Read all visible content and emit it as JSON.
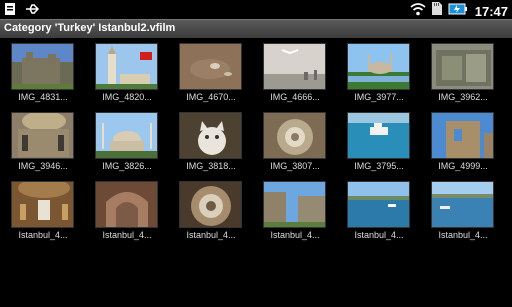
{
  "status": {
    "time": "17:47"
  },
  "titlebar": {
    "title": "Category 'Turkey' Istanbul2.vfilm"
  },
  "photos": [
    {
      "caption": "IMG_4831..."
    },
    {
      "caption": "IMG_4820..."
    },
    {
      "caption": "IMG_4670..."
    },
    {
      "caption": "IMG_4666..."
    },
    {
      "caption": "IMG_3977..."
    },
    {
      "caption": "IMG_3962..."
    },
    {
      "caption": "IMG_3946..."
    },
    {
      "caption": "IMG_3826..."
    },
    {
      "caption": "IMG_3818..."
    },
    {
      "caption": "IMG_3807..."
    },
    {
      "caption": "IMG_3795..."
    },
    {
      "caption": "IMG_4999..."
    },
    {
      "caption": "Istanbul_4..."
    },
    {
      "caption": "Istanbul_4..."
    },
    {
      "caption": "Istanbul_4..."
    },
    {
      "caption": "Istanbul_4..."
    },
    {
      "caption": "Istanbul_4..."
    },
    {
      "caption": "Istanbul_4..."
    }
  ]
}
